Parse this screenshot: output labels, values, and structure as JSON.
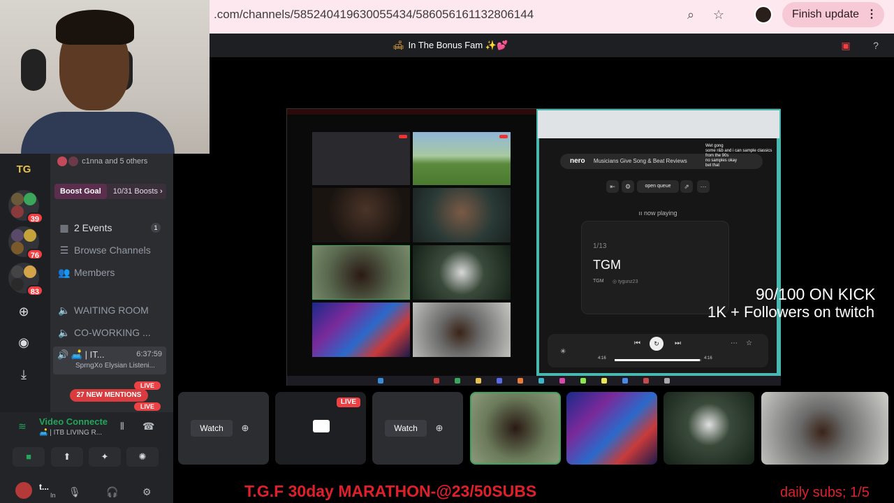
{
  "browser": {
    "url": ".com/channels/585240419630055434/586056161132806144",
    "finish_update": "Finish update",
    "zoom_icon": "magnifier-icon",
    "bookmark_icon": "star-icon"
  },
  "header": {
    "title": "In The Bonus Fam ✨💕"
  },
  "rail": {
    "logo": "TG",
    "servers": [
      {
        "badge": "39"
      },
      {
        "badge": "76"
      },
      {
        "badge": "83"
      }
    ]
  },
  "sidebar": {
    "others": "c1nna and 5 others",
    "boost_goal": "Boost Goal",
    "boost_count": "10/31 Boosts",
    "events": "2 Events",
    "events_badge": "1",
    "browse": "Browse Channels",
    "members": "Members",
    "waiting_room": "WAITING ROOM",
    "coworking": "CO-WORKING ...",
    "active_channel": "🛋️ | IT...",
    "active_timer": "6:37:59",
    "active_sub": "SprngXo Elysian Listeni...",
    "new_mentions": "27 NEW MENTIONS",
    "live": "LIVE"
  },
  "voice": {
    "status": "Video Connecte",
    "channel": "🛋️ | ITB LIVING R..."
  },
  "user": {
    "name": "t...",
    "status": "In"
  },
  "stream": {
    "nero_brand": "nero",
    "nero_tagline": "Musicians Give Song & Beat Reviews",
    "open_queue": "open queue",
    "now_playing": "now playing",
    "track_index": "1/13",
    "track_title": "TGM",
    "track_artist": "TGM",
    "track_handle": "tygunz23",
    "time_start": "4:16",
    "time_end": "4:16",
    "chat_lines": [
      "Wet gong",
      "some r&b and i can sample classics",
      "from the 90s",
      "no samples okay",
      "bet that"
    ]
  },
  "overlay": {
    "kick": "90/100 ON KICK",
    "twitch": "1K + Followers on twitch",
    "marathon": "T.G.F 30day MARATHON-@23/50SUBS",
    "daily_subs": "daily subs; 1/5"
  },
  "participants": {
    "watch": "Watch",
    "live": "LIVE"
  },
  "colors": {
    "accent_green": "#23a55a",
    "live_red": "#ed4245",
    "overlay_red": "#e11f2a",
    "browser_pink": "#fde8ef"
  }
}
